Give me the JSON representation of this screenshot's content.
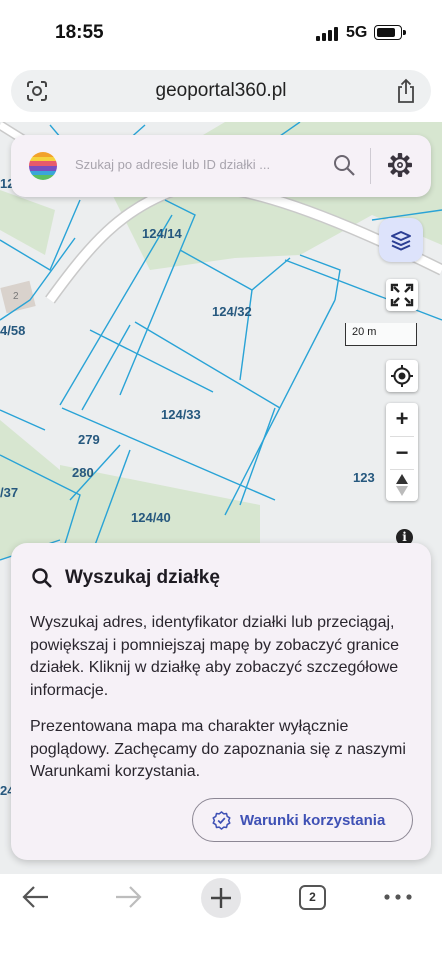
{
  "status_bar": {
    "time": "18:55",
    "network": "5G",
    "signal_icon": "signal-bars-icon",
    "battery_icon": "battery-icon"
  },
  "browser": {
    "url": "geoportal360.pl",
    "left_icon": "page-scan-icon",
    "right_icon": "share-icon"
  },
  "search": {
    "placeholder": "Szukaj po adresie lub ID działki ...",
    "search_icon": "search-icon",
    "settings_icon": "gear-icon"
  },
  "map": {
    "scale_label": "20 m",
    "building_number": "2",
    "parcels": [
      "124/14",
      "124/32",
      "124/33",
      "279",
      "280",
      "124/40",
      "123",
      "4/58",
      "/37",
      "12",
      "24"
    ],
    "controls": {
      "layers_icon": "layers-icon",
      "fullscreen_icon": "fullscreen-icon",
      "locate_icon": "locate-icon",
      "zoom_in": "+",
      "zoom_out": "−",
      "compass_icon": "compass-icon",
      "info_icon": "i"
    }
  },
  "info_card": {
    "title": "Wyszukaj działkę",
    "paragraph1": "Wyszukaj adres, identyfikator działki lub przeciągaj, powiększaj i pomniejszaj mapę by zobaczyć granice działek. Kliknij w działkę aby zobaczyć szczegółowe informacje.",
    "paragraph2": "Prezentowana mapa ma charakter wyłącznie poglądowy. Zachęcamy do zapoznania się z naszymi Warunkami korzystania.",
    "terms_button": "Warunki korzystania"
  },
  "toolbar": {
    "back_icon": "back-arrow-icon",
    "forward_icon": "forward-arrow-icon",
    "new_tab_icon": "plus-icon",
    "tab_count": "2",
    "more_icon": "more-dots-icon"
  },
  "colors": {
    "parcel_line": "#29a3d6",
    "parcel_label": "#26587e",
    "green_area": "#d7e6d0",
    "road": "#ffffff",
    "accent": "#3f51b5",
    "card_bg": "#f6f1f7",
    "layers_bg": "#dde3fb"
  }
}
